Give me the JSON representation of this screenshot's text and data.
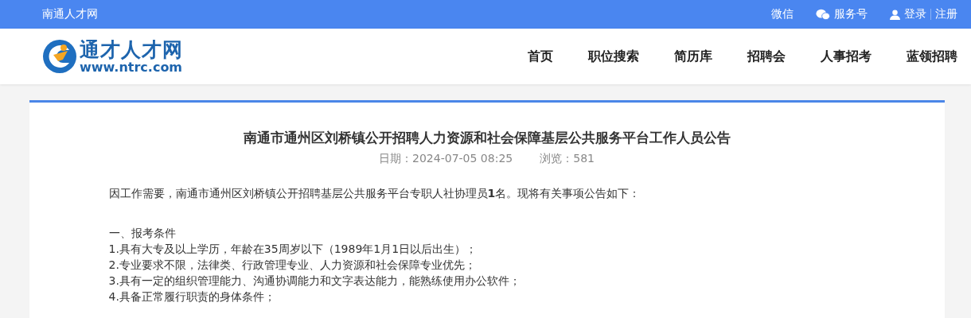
{
  "topbar": {
    "site_name": "南通人才网",
    "links": [
      {
        "kind": "plain",
        "label": "微信"
      },
      {
        "kind": "wechat",
        "label": "服务号"
      }
    ],
    "login": "登录",
    "register": "注册"
  },
  "header": {
    "logo": {
      "name": "通才人才网",
      "url": "www.ntrc.com"
    },
    "nav": [
      "首页",
      "职位搜索",
      "简历库",
      "招聘会",
      "人事招考",
      "蓝领招聘"
    ]
  },
  "article": {
    "title": "南通市通州区刘桥镇公开招聘人力资源和社会保障基层公共服务平台工作人员公告",
    "date": "日期：2024-07-05 08:25",
    "views": "浏览：581",
    "intro": "因工作需要，南通市通州区刘桥镇公开招聘基层公共服务平台专职人社协理员**1**名。现将有关事项公告如下：",
    "section": "一、报考条件",
    "items": [
      "1.具有大专及以上学历，年龄在35周岁以下（1989年1月1日以后出生）；",
      "2.专业要求不限，法律类、行政管理专业、人力资源和社会保障专业优先；",
      "3.具有一定的组织管理能力、沟通协调能力和文字表达能力，能熟练使用办公软件；",
      "4.具备正常履行职责的身体条件；"
    ]
  }
}
